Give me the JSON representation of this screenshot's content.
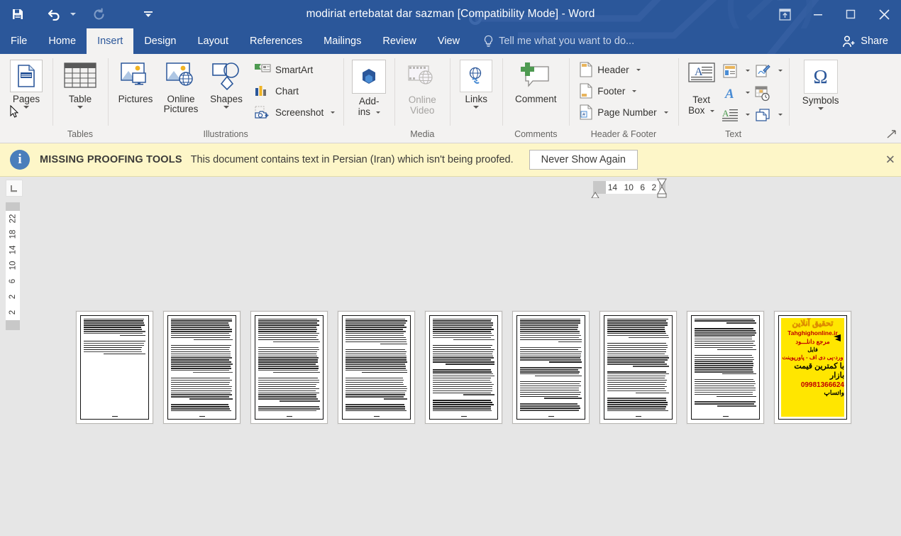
{
  "window": {
    "title": "modiriat ertebatat dar sazman [Compatibility Mode] - Word",
    "accent_color": "#2b579a",
    "quick_access": [
      {
        "name": "save",
        "label": "Save",
        "icon": "save-icon",
        "enabled": true
      },
      {
        "name": "undo",
        "label": "Undo",
        "icon": "undo-icon",
        "enabled": true
      },
      {
        "name": "redo",
        "label": "Redo",
        "icon": "redo-icon",
        "enabled": false
      },
      {
        "name": "customize",
        "label": "Customize Quick Access Toolbar",
        "icon": "chevron-down-icon",
        "enabled": true
      }
    ],
    "controls": [
      {
        "name": "ribbon-display-options",
        "label": "Ribbon Display Options",
        "glyph": "⬆"
      },
      {
        "name": "minimize",
        "label": "Minimize",
        "glyph": "─"
      },
      {
        "name": "restore",
        "label": "Restore Down",
        "glyph": "☐"
      },
      {
        "name": "close",
        "label": "Close",
        "glyph": "✕"
      }
    ]
  },
  "tabs": {
    "items": [
      {
        "label": "File",
        "active": false
      },
      {
        "label": "Home",
        "active": false
      },
      {
        "label": "Insert",
        "active": true
      },
      {
        "label": "Design",
        "active": false
      },
      {
        "label": "Layout",
        "active": false
      },
      {
        "label": "References",
        "active": false
      },
      {
        "label": "Mailings",
        "active": false
      },
      {
        "label": "Review",
        "active": false
      },
      {
        "label": "View",
        "active": false
      }
    ],
    "tell_me": "Tell me what you want to do...",
    "share": "Share"
  },
  "ribbon": {
    "groups": [
      {
        "name": "pages",
        "label": "",
        "buttons": [
          {
            "label": "Pages",
            "icon": "pages-icon",
            "selected": true,
            "has_caret": true
          }
        ]
      },
      {
        "name": "tables",
        "label": "Tables",
        "buttons": [
          {
            "label": "Table",
            "icon": "table-icon",
            "has_caret": true
          }
        ]
      },
      {
        "name": "illustrations",
        "label": "Illustrations",
        "buttons": [
          {
            "label": "Pictures",
            "icon": "pictures-icon",
            "has_caret": false
          },
          {
            "label": "Online Pictures",
            "icon": "online-pictures-icon",
            "has_caret": false
          },
          {
            "label": "Shapes",
            "icon": "shapes-icon",
            "has_caret": true
          }
        ],
        "small_buttons": [
          {
            "label": "SmartArt",
            "icon": "smartart-icon",
            "has_caret": false
          },
          {
            "label": "Chart",
            "icon": "chart-icon",
            "has_caret": false
          },
          {
            "label": "Screenshot",
            "icon": "screenshot-icon",
            "has_caret": true
          }
        ]
      },
      {
        "name": "add-ins",
        "label": "",
        "buttons": [
          {
            "label": "Add-ins",
            "icon": "addins-icon",
            "has_caret": true
          }
        ]
      },
      {
        "name": "media",
        "label": "Media",
        "buttons": [
          {
            "label": "Online Video",
            "icon": "online-video-icon",
            "disabled": true
          }
        ]
      },
      {
        "name": "links",
        "label": "",
        "buttons": [
          {
            "label": "Links",
            "icon": "links-icon",
            "has_caret": true
          }
        ]
      },
      {
        "name": "comments",
        "label": "Comments",
        "buttons": [
          {
            "label": "Comment",
            "icon": "comment-icon"
          }
        ]
      },
      {
        "name": "header-footer",
        "label": "Header & Footer",
        "small_buttons": [
          {
            "label": "Header",
            "icon": "header-icon",
            "has_caret": true
          },
          {
            "label": "Footer",
            "icon": "footer-icon",
            "has_caret": true
          },
          {
            "label": "Page Number",
            "icon": "page-number-icon",
            "has_caret": true
          }
        ]
      },
      {
        "name": "text",
        "label": "Text",
        "buttons": [
          {
            "label": "Text Box",
            "icon": "text-box-icon",
            "has_caret": true
          }
        ],
        "mini_buttons": [
          {
            "name": "quick-parts-icon"
          },
          {
            "name": "signature-line-icon"
          },
          {
            "name": "wordart-icon"
          },
          {
            "name": "date-time-icon"
          },
          {
            "name": "drop-cap-icon"
          },
          {
            "name": "object-icon"
          }
        ]
      },
      {
        "name": "symbols",
        "label": "",
        "buttons": [
          {
            "label": "Symbols",
            "icon": "symbols-icon",
            "glyph": "Ω",
            "has_caret": true
          }
        ]
      }
    ],
    "collapse_label": "Collapse the Ribbon"
  },
  "message_bar": {
    "strong": "MISSING PROOFING TOOLS",
    "text": "This document contains text in Persian (Iran) which isn't being proofed.",
    "button": "Never Show Again",
    "close": "✕",
    "background": "#fdf6c8"
  },
  "ruler": {
    "tab_stop_glyph": "L",
    "horizontal_ticks": [
      "14",
      "10",
      "6",
      "2"
    ],
    "vertical_ticks": [
      "2",
      "2",
      "6",
      "10",
      "14",
      "18",
      "22"
    ]
  },
  "document": {
    "page_count": 9,
    "pages": [
      {
        "index": 1,
        "type": "text",
        "paragraphs": [
          9,
          7
        ],
        "align": "rtl",
        "fill": "partial"
      },
      {
        "index": 2,
        "type": "text",
        "paragraphs": [
          11,
          14,
          11,
          10
        ],
        "align": "rtl",
        "fill": "full"
      },
      {
        "index": 3,
        "type": "text",
        "paragraphs": [
          12,
          13,
          12,
          10
        ],
        "align": "rtl",
        "fill": "full"
      },
      {
        "index": 4,
        "type": "text",
        "paragraphs": [
          13,
          12,
          11,
          11
        ],
        "align": "rtl",
        "fill": "full"
      },
      {
        "index": 5,
        "type": "text",
        "paragraphs": [
          11,
          10,
          13,
          12
        ],
        "align": "rtl",
        "fill": "full"
      },
      {
        "index": 6,
        "type": "text",
        "paragraphs": [
          12,
          8,
          5,
          9,
          6,
          4
        ],
        "align": "rtl",
        "fill": "full"
      },
      {
        "index": 7,
        "type": "text",
        "paragraphs": [
          10,
          12,
          11,
          9
        ],
        "align": "rtl",
        "fill": "full"
      },
      {
        "index": 8,
        "type": "text",
        "paragraphs": [
          3,
          11,
          10,
          9,
          3
        ],
        "align": "rtl",
        "fill": "partial"
      },
      {
        "index": 9,
        "type": "advertisement",
        "align": "rtl"
      }
    ],
    "advertisement": {
      "heading": "تحقیق آنلاین",
      "site": "Tahghighonline.ir",
      "line3": "مرجع دانلـــود",
      "line4": "فایل",
      "line5": "ورد-پی دی اف - پاورپوینت",
      "line6": "با کمترین قیمت بازار",
      "phone": "09981366624",
      "whatsapp": "واتساپ",
      "background": "#ffe600"
    }
  }
}
